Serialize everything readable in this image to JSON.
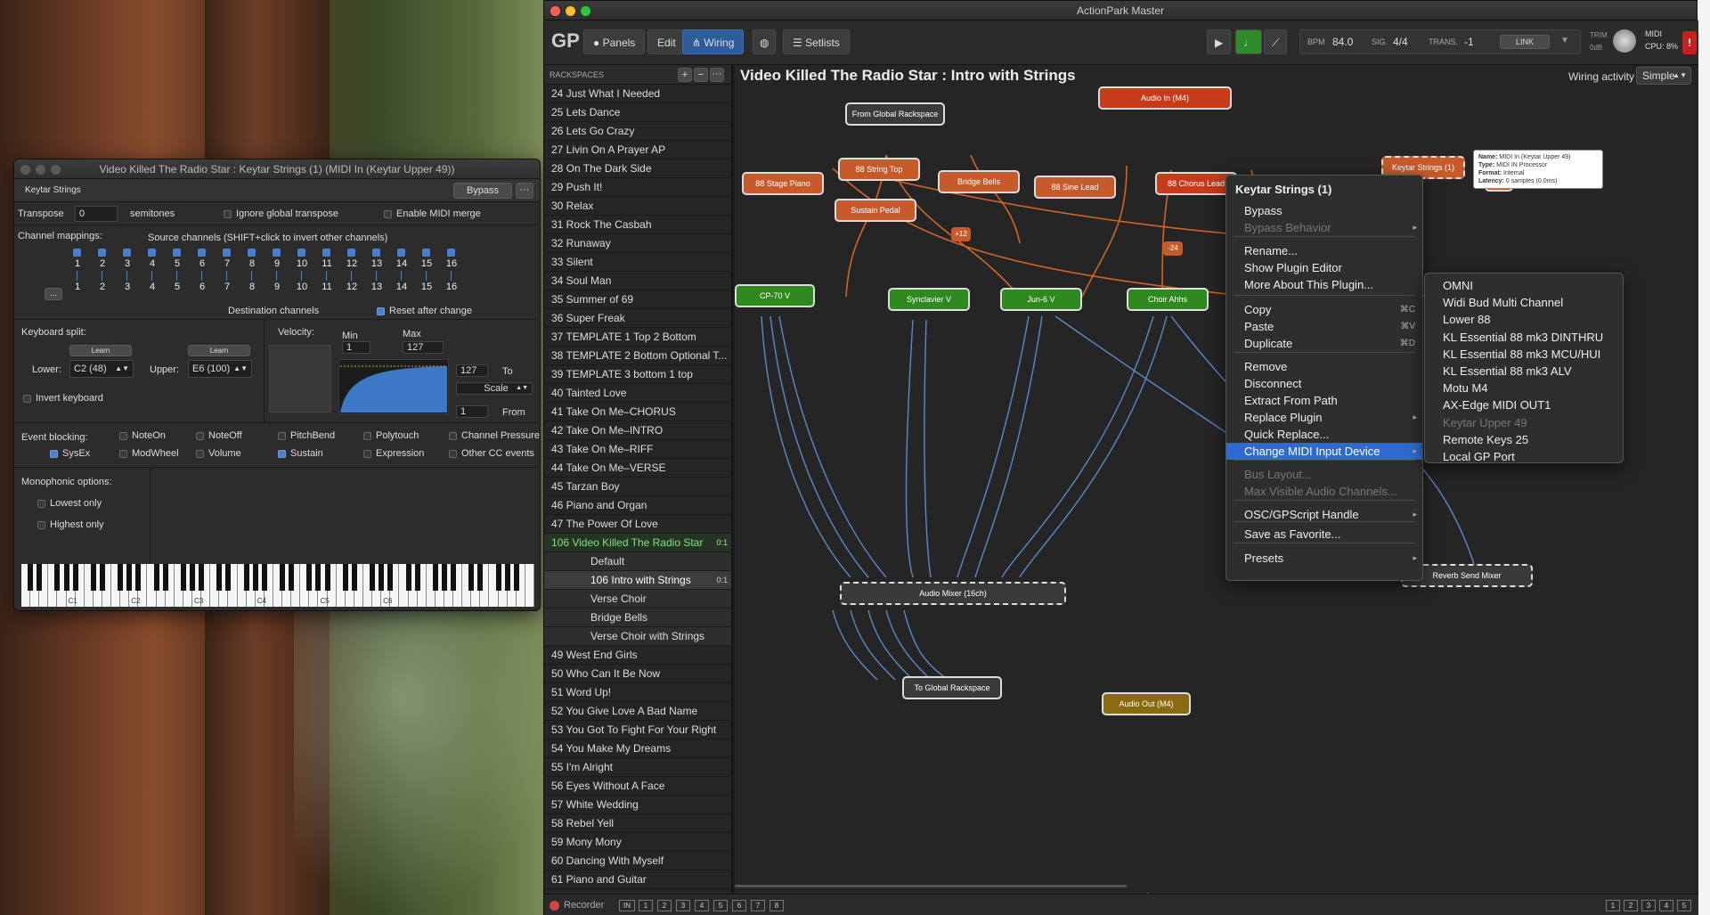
{
  "plugin_window": {
    "title": "Video Killed The Radio Star : Keytar Strings (1) (MIDI In (Keytar Upper 49))",
    "plugin_name": "Keytar Strings",
    "bypass": "Bypass",
    "more": "···",
    "transpose_label": "Transpose",
    "transpose_value": "0",
    "semitones": "semitones",
    "ignore_global": "Ignore global transpose",
    "enable_merge": "Enable MIDI merge",
    "channel_mappings": "Channel mappings:",
    "source_channels": "Source channels (SHIFT+click to invert other channels)",
    "channels": [
      "1",
      "2",
      "3",
      "4",
      "5",
      "6",
      "7",
      "8",
      "9",
      "10",
      "11",
      "12",
      "13",
      "14",
      "15",
      "16"
    ],
    "dots_btn": "...",
    "destination_channels": "Destination channels",
    "reset_after_change": "Reset after change",
    "keyboard_split": "Keyboard split:",
    "learn": "Learn",
    "lower_label": "Lower:",
    "lower_value": "C2 (48)",
    "upper_label": "Upper:",
    "upper_value": "E6 (100)",
    "invert_keyboard": "Invert keyboard",
    "velocity": "Velocity:",
    "min": "Min",
    "max": "Max",
    "min_value": "1",
    "max_value": "127",
    "to_value": "127",
    "to": "To",
    "scale": "Scale",
    "from_value": "1",
    "from": "From",
    "event_blocking": "Event blocking:",
    "events": [
      {
        "label": "NoteOn",
        "checked": false
      },
      {
        "label": "NoteOff",
        "checked": false
      },
      {
        "label": "PitchBend",
        "checked": false
      },
      {
        "label": "Polytouch",
        "checked": false
      },
      {
        "label": "Channel Pressure",
        "checked": false
      },
      {
        "label": "SysEx",
        "checked": true
      },
      {
        "label": "ModWheel",
        "checked": false
      },
      {
        "label": "Volume",
        "checked": false
      },
      {
        "label": "Sustain",
        "checked": true
      },
      {
        "label": "Expression",
        "checked": false
      },
      {
        "label": "Other CC events",
        "checked": false
      }
    ],
    "monophonic": "Monophonic options:",
    "lowest_only": "Lowest only",
    "highest_only": "Highest only",
    "octaves": [
      "C1",
      "C2",
      "C3",
      "C4",
      "C5",
      "C6"
    ]
  },
  "main_window": {
    "title": "ActionPark Master",
    "tabs": [
      {
        "label": "Panels"
      },
      {
        "label": "Edit"
      },
      {
        "label": "Wiring"
      },
      {
        "label": "Setlists"
      }
    ],
    "bpm_label": "BPM",
    "bpm": "84.0",
    "sig_label": "SIG.",
    "sig": "4/4",
    "trans_label": "TRANS.",
    "trans": "-1",
    "link": "LINK",
    "trim_label": "TRIM",
    "trim_value": "0dB",
    "midi_label": "MIDI",
    "cpu_label": "CPU:",
    "cpu_value": "8%",
    "rackspaces_label": "RACKSPACES",
    "rackspaces": [
      {
        "num": "24",
        "name": "Just What I Needed"
      },
      {
        "num": "25",
        "name": "Lets Dance"
      },
      {
        "num": "26",
        "name": "Lets Go Crazy"
      },
      {
        "num": "27",
        "name": "Livin On A Prayer AP"
      },
      {
        "num": "28",
        "name": "On The Dark Side"
      },
      {
        "num": "29",
        "name": "Push It!"
      },
      {
        "num": "30",
        "name": "Relax"
      },
      {
        "num": "31",
        "name": "Rock The Casbah"
      },
      {
        "num": "32",
        "name": "Runaway"
      },
      {
        "num": "33",
        "name": "Silent"
      },
      {
        "num": "34",
        "name": "Soul Man"
      },
      {
        "num": "35",
        "name": "Summer of 69"
      },
      {
        "num": "36",
        "name": "Super Freak"
      },
      {
        "num": "37",
        "name": "TEMPLATE 1 Top 2 Bottom"
      },
      {
        "num": "38",
        "name": "TEMPLATE 2 Bottom Optional T..."
      },
      {
        "num": "39",
        "name": "TEMPLATE 3 bottom 1 top"
      },
      {
        "num": "40",
        "name": "Tainted Love"
      },
      {
        "num": "41",
        "name": "Take On Me–CHORUS"
      },
      {
        "num": "42",
        "name": "Take On Me–INTRO"
      },
      {
        "num": "43",
        "name": "Take On Me–RIFF"
      },
      {
        "num": "44",
        "name": "Take On Me–VERSE"
      },
      {
        "num": "45",
        "name": "Tarzan Boy"
      },
      {
        "num": "46",
        "name": "Piano and Organ"
      },
      {
        "num": "47",
        "name": "The Power Of Love"
      }
    ],
    "current": {
      "num": "106",
      "name": "Video Killed The Radio Star",
      "badge": "0:1"
    },
    "variations": [
      {
        "num": "",
        "name": "Default",
        "badge": ""
      },
      {
        "num": "106",
        "name": "Intro with Strings",
        "badge": "0:1"
      },
      {
        "num": "",
        "name": "Verse Choir",
        "badge": ""
      },
      {
        "num": "",
        "name": "Bridge Bells",
        "badge": ""
      },
      {
        "num": "",
        "name": "Verse Choir with Strings",
        "badge": ""
      }
    ],
    "rackspaces_after": [
      {
        "num": "49",
        "name": "West End Girls"
      },
      {
        "num": "50",
        "name": "Who Can It Be Now"
      },
      {
        "num": "51",
        "name": "Word Up!"
      },
      {
        "num": "52",
        "name": "You Give Love A Bad Name"
      },
      {
        "num": "53",
        "name": "You Got To Fight For Your Right"
      },
      {
        "num": "54",
        "name": "You Make My Dreams"
      },
      {
        "num": "55",
        "name": "I'm Alright"
      },
      {
        "num": "56",
        "name": "Eyes Without A Face"
      },
      {
        "num": "57",
        "name": "White Wedding"
      },
      {
        "num": "58",
        "name": "Rebel Yell"
      },
      {
        "num": "59",
        "name": "Mony Mony"
      },
      {
        "num": "60",
        "name": "Dancing With Myself"
      },
      {
        "num": "61",
        "name": "Piano and Guitar"
      }
    ],
    "canvas_title": "Video Killed The Radio Star : Intro with Strings",
    "wiring_activity": "Wiring activity",
    "wiring_mode": "Simple",
    "nodes": {
      "audio_in": "Audio In (M4)",
      "from_global": "From Global Rackspace",
      "stage_piano": "88 Stage Piano",
      "string_top": "88 String Top",
      "bridge_bells": "Bridge Bells",
      "sine_lead": "88 Sine Lead",
      "chorus_lead": "88 Chorus Lead",
      "sustain": "Sustain Pedal",
      "keytar": "Keytar Strings (1)",
      "cp70": "CP-70 V",
      "synclavier": "Synclavier V",
      "jun6": "Jun-6 V",
      "choir": "Choir Ahhs",
      "mixer": "Audio Mixer (16ch)",
      "reverb": "Reverb Send Mixer",
      "to_global": "To Global Rackspace",
      "audio_out": "Audio Out (M4)",
      "plus12": "+12",
      "minus24": "-24"
    },
    "tooltip": [
      "Name:",
      "MIDI In (Keytar Upper 49)",
      "Type:",
      "MIDI IN Processor",
      "Format:",
      "Internal",
      "Latency:",
      "0 samples (0.0ms)"
    ],
    "recorder": "Recorder",
    "recorder_in": "IN",
    "page_buttons": [
      "1",
      "2",
      "3",
      "4",
      "5",
      "6",
      "7",
      "8"
    ],
    "right_buttons": [
      "1",
      "2",
      "3",
      "4",
      "5"
    ]
  },
  "context_menu": {
    "header": "Keytar Strings (1)",
    "items": [
      {
        "label": "Bypass",
        "shortcut": "",
        "arrow": "",
        "disabled": false
      },
      {
        "label": "Bypass Behavior",
        "shortcut": "",
        "arrow": "▸",
        "disabled": true
      },
      {
        "label": "Rename...",
        "shortcut": "",
        "arrow": "",
        "disabled": false
      },
      {
        "label": "Show Plugin Editor",
        "shortcut": "",
        "arrow": "",
        "disabled": false
      },
      {
        "label": "More About This Plugin...",
        "shortcut": "",
        "arrow": "",
        "disabled": false
      },
      {
        "label": "Copy",
        "shortcut": "⌘C",
        "arrow": "",
        "disabled": false
      },
      {
        "label": "Paste",
        "shortcut": "⌘V",
        "arrow": "",
        "disabled": false
      },
      {
        "label": "Duplicate",
        "shortcut": "⌘D",
        "arrow": "",
        "disabled": false
      },
      {
        "label": "Remove",
        "shortcut": "",
        "arrow": "",
        "disabled": false
      },
      {
        "label": "Disconnect",
        "shortcut": "",
        "arrow": "",
        "disabled": false
      },
      {
        "label": "Extract From Path",
        "shortcut": "",
        "arrow": "",
        "disabled": false
      },
      {
        "label": "Replace Plugin",
        "shortcut": "",
        "arrow": "▸",
        "disabled": false
      },
      {
        "label": "Quick Replace...",
        "shortcut": "",
        "arrow": "",
        "disabled": false
      },
      {
        "label": "Change MIDI Input Device",
        "shortcut": "",
        "arrow": "▸",
        "disabled": false
      },
      {
        "label": "Bus Layout...",
        "shortcut": "",
        "arrow": "",
        "disabled": true
      },
      {
        "label": "Max Visible Audio Channels...",
        "shortcut": "",
        "arrow": "",
        "disabled": true
      },
      {
        "label": "OSC/GPScript Handle",
        "shortcut": "",
        "arrow": "▸",
        "disabled": false
      },
      {
        "label": "Save as Favorite...",
        "shortcut": "",
        "arrow": "",
        "disabled": false
      },
      {
        "label": "Presets",
        "shortcut": "",
        "arrow": "▸",
        "disabled": false
      }
    ],
    "submenu": [
      {
        "label": "OMNI",
        "disabled": false
      },
      {
        "label": "Widi Bud Multi Channel",
        "disabled": false
      },
      {
        "label": "Lower 88",
        "disabled": false
      },
      {
        "label": "KL Essential 88 mk3 DINTHRU",
        "disabled": false
      },
      {
        "label": "KL Essential 88 mk3 MCU/HUI",
        "disabled": false
      },
      {
        "label": "KL Essential 88 mk3 ALV",
        "disabled": false
      },
      {
        "label": "Motu M4",
        "disabled": false
      },
      {
        "label": "AX-Edge MIDI OUT1",
        "disabled": false
      },
      {
        "label": "Keytar Upper 49",
        "disabled": true
      },
      {
        "label": "Remote Keys 25",
        "disabled": false
      },
      {
        "label": "Local GP Port",
        "disabled": false
      }
    ]
  }
}
